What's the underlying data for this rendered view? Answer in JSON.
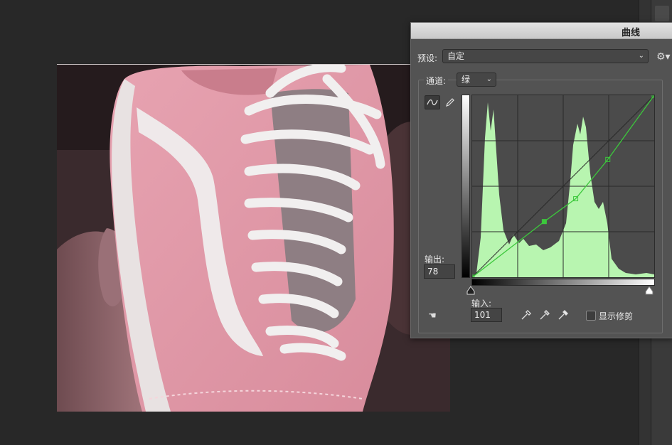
{
  "dialog": {
    "title": "曲线",
    "preset_label": "预设:",
    "preset_value": "自定",
    "channel_label": "通道:",
    "channel_value": "绿",
    "output_label": "输出:",
    "output_value": "78",
    "input_label": "输入:",
    "input_value": "101",
    "show_clipping_label": "显示修剪"
  },
  "icons": {
    "gear": "gear-icon",
    "curve_tool": "curve-point-icon",
    "pencil_tool": "pencil-icon",
    "auto_hand": "hand-icon",
    "eyedroppers": [
      "black-point-eyedropper-icon",
      "gray-point-eyedropper-icon",
      "white-point-eyedropper-icon"
    ]
  },
  "colors": {
    "histogram_fill": "#b8f5b0",
    "curve_line": "#3cc83c",
    "baseline": "#2a2a2a"
  },
  "curve": {
    "input_range": [
      0,
      255
    ],
    "output_range": [
      0,
      255
    ],
    "points": [
      [
        0,
        0
      ],
      [
        101,
        78
      ],
      [
        145,
        110
      ],
      [
        190,
        165
      ],
      [
        255,
        255
      ]
    ]
  }
}
